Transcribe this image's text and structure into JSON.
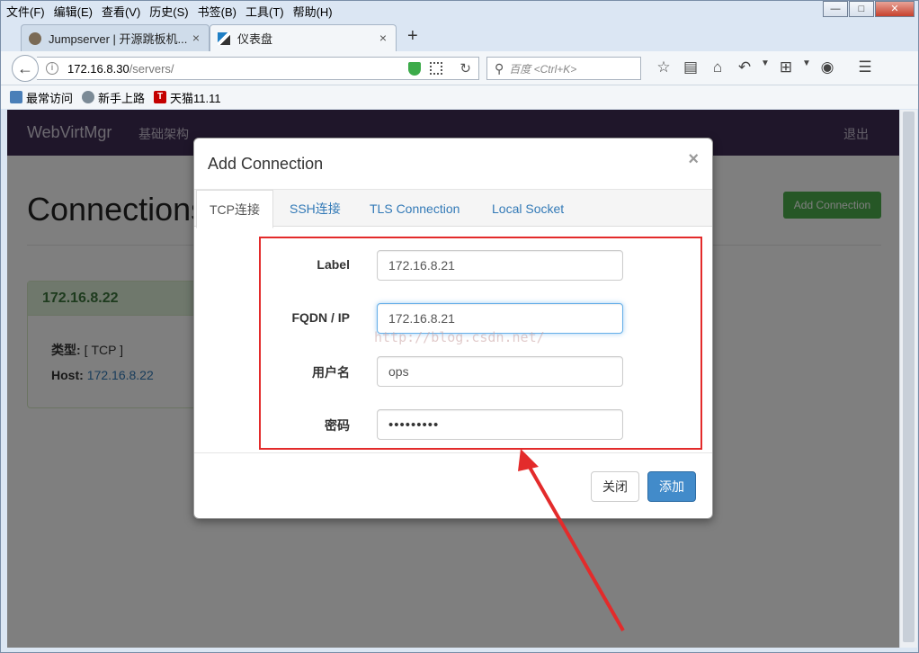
{
  "menubar": {
    "items": [
      "文件(F)",
      "编辑(E)",
      "查看(V)",
      "历史(S)",
      "书签(B)",
      "工具(T)",
      "帮助(H)"
    ]
  },
  "tabs": [
    {
      "label": "Jumpserver | 开源跳板机...",
      "close": "×"
    },
    {
      "label": "仪表盘",
      "close": "×"
    }
  ],
  "newtab": "+",
  "address": {
    "host": "172.16.8.30",
    "path": "/servers/"
  },
  "search": {
    "placeholder": "百度 <Ctrl+K>"
  },
  "bookmarks": [
    {
      "label": "最常访问"
    },
    {
      "label": "新手上路"
    },
    {
      "label": "天猫11.11",
      "icon_text": "T"
    }
  ],
  "app": {
    "brand": "WebVirtMgr",
    "nav_link": "基础架构",
    "logout": "退出",
    "page_title": "Connections",
    "add_connection_button": "Add Connection",
    "card": {
      "title": "172.16.8.22",
      "type_label": "类型:",
      "type_value": "[ TCP ]",
      "host_label": "Host:",
      "host_value": "172.16.8.22"
    }
  },
  "modal": {
    "title": "Add Connection",
    "close": "×",
    "tabs": [
      "TCP连接",
      "SSH连接",
      "TLS Connection",
      "Local Socket"
    ],
    "fields": {
      "label": {
        "label": "Label",
        "value": "172.16.8.21"
      },
      "fqdn": {
        "label": "FQDN / IP",
        "value": "172.16.8.21"
      },
      "username": {
        "label": "用户名",
        "value": "ops"
      },
      "password": {
        "label": "密码",
        "value": "•••••••••"
      }
    },
    "close_button": "关闭",
    "add_button": "添加"
  },
  "watermark": "http://blog.csdn.net/",
  "colors": {
    "annotation": "#e32b2b",
    "navbar": "#3f2d54",
    "primary": "#428bca",
    "success": "#4cae4c"
  }
}
